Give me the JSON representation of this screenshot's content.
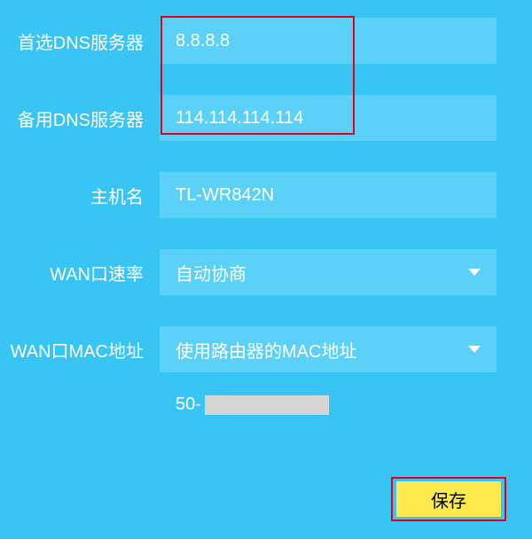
{
  "fields": {
    "primary_dns": {
      "label": "首选DNS服务器",
      "value": "8.8.8.8"
    },
    "secondary_dns": {
      "label": "备用DNS服务器",
      "value": "114.114.114.114"
    },
    "hostname": {
      "label": "主机名",
      "value": "TL-WR842N"
    },
    "wan_speed": {
      "label": "WAN口速率",
      "value": "自动协商"
    },
    "wan_mac": {
      "label": "WAN口MAC地址",
      "value": "使用路由器的MAC地址"
    },
    "mac_prefix": "50-"
  },
  "buttons": {
    "save": "保存"
  }
}
